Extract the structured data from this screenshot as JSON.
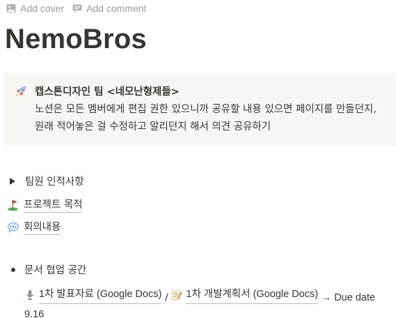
{
  "top_actions": {
    "add_cover": "Add cover",
    "add_comment": "Add comment"
  },
  "page_title": "NemoBros",
  "callout": {
    "emoji": "rocket-icon",
    "title": "캡스톤디자인 팀 <네모난형제들>",
    "body": "노션은 모든 멤버에게 편집 권한 있으니까 공유할 내용 있으면 페이지를 만들던지, 원래 적어놓은 걸 수정하고 알리던지 해서 의견 공유하기"
  },
  "toggle": {
    "label": "팀원 인적사항"
  },
  "links": [
    {
      "icon": "golf-flag-icon",
      "label": "프로젝트 목적"
    },
    {
      "icon": "speech-bubble-icon",
      "label": "회의내용"
    }
  ],
  "bullet": {
    "label": "문서 협업 공간"
  },
  "docs": {
    "doc1": {
      "icon": "microphone-icon",
      "label": "1차 발표자료 (Google Docs)"
    },
    "separator": "/",
    "doc2": {
      "icon": "memo-icon",
      "label": "1차 개발계획서 (Google Docs)"
    },
    "due": "→ Due date 9.16"
  },
  "colors": {
    "text": "#37352f",
    "muted": "#9b9a97",
    "callout_bg": "#f7f6f3"
  }
}
